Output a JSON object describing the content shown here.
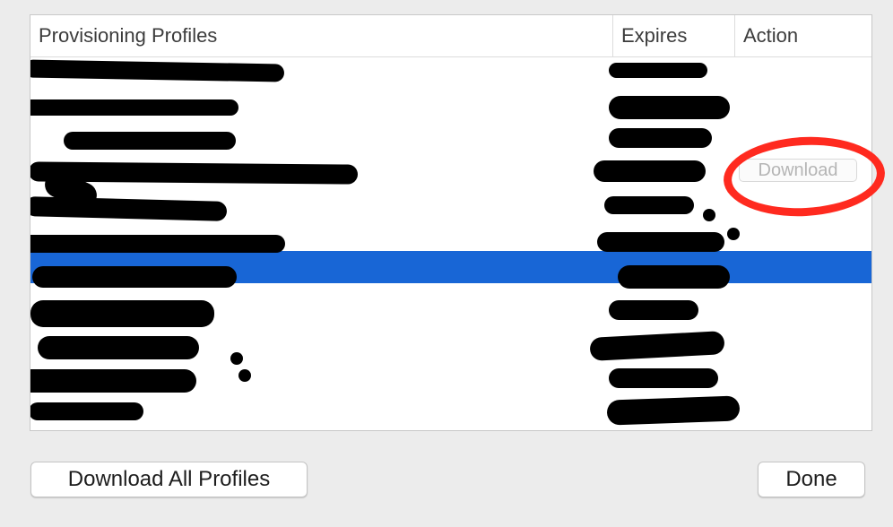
{
  "table": {
    "headers": {
      "name": "Provisioning Profiles",
      "expires": "Expires",
      "action": "Action"
    },
    "rows": [
      {
        "name": "",
        "expires": "",
        "action": ""
      },
      {
        "name": "",
        "expires": "",
        "action": ""
      },
      {
        "name": "",
        "expires": "",
        "action": ""
      },
      {
        "name": "",
        "expires": "",
        "action": "Download"
      },
      {
        "name": "",
        "expires": "",
        "action": ""
      },
      {
        "name": "",
        "expires": "",
        "action": ""
      },
      {
        "name": "",
        "expires": "",
        "action": "",
        "selected": true
      },
      {
        "name": "",
        "expires": "",
        "action": ""
      },
      {
        "name": "",
        "expires": "",
        "action": ""
      },
      {
        "name": "",
        "expires": "",
        "action": ""
      },
      {
        "name": "",
        "expires": "",
        "action": ""
      },
      {
        "name": "",
        "expires": "",
        "action": ""
      }
    ]
  },
  "buttons": {
    "download_all": "Download All Profiles",
    "done": "Done"
  },
  "colors": {
    "selection": "#1866d6",
    "annotation": "#ff2a1f"
  }
}
